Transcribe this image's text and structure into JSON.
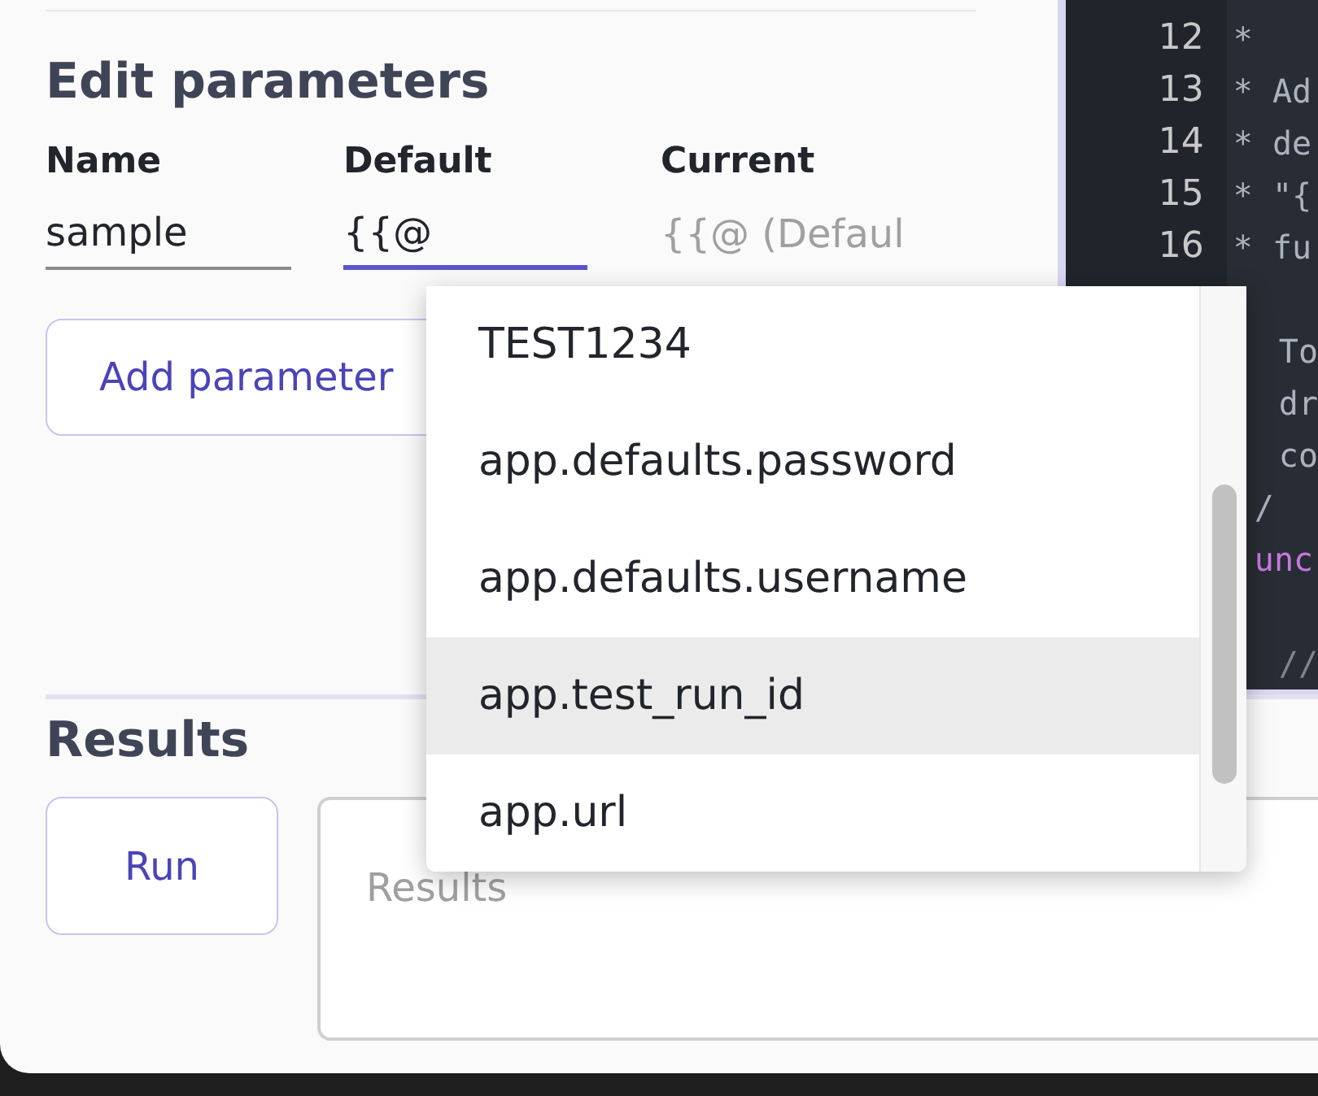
{
  "parameters": {
    "title": "Edit parameters",
    "columns": [
      "Name",
      "Default",
      "Current"
    ],
    "rows": [
      {
        "name": "sample",
        "default": "{{@",
        "default_focused": true,
        "current_placeholder": "{{@ (Defaul"
      }
    ],
    "add_button": "Add parameter"
  },
  "autocomplete": {
    "items": [
      {
        "label": "TEST1234",
        "selected": false
      },
      {
        "label": "app.defaults.password",
        "selected": false
      },
      {
        "label": "app.defaults.username",
        "selected": false
      },
      {
        "label": "app.test_run_id",
        "selected": true
      },
      {
        "label": "app.url",
        "selected": false
      }
    ]
  },
  "editor": {
    "lines": [
      {
        "number": "12",
        "text": "*"
      },
      {
        "number": "13",
        "text": "* Ad"
      },
      {
        "number": "14",
        "text": "* de"
      },
      {
        "number": "15",
        "text": "* \"{"
      },
      {
        "number": "16",
        "text": "* fu"
      },
      {
        "kind": "blank"
      },
      {
        "text": "To"
      },
      {
        "text": "dr"
      },
      {
        "text": "co"
      },
      {
        "text": "/",
        "kind": "close"
      },
      {
        "text": "unc",
        "kind": "keyword"
      },
      {
        "kind": "blank"
      },
      {
        "text": "//",
        "kind": "comment"
      }
    ]
  },
  "results": {
    "title": "Results",
    "run_button": "Run",
    "placeholder": "Results"
  }
}
